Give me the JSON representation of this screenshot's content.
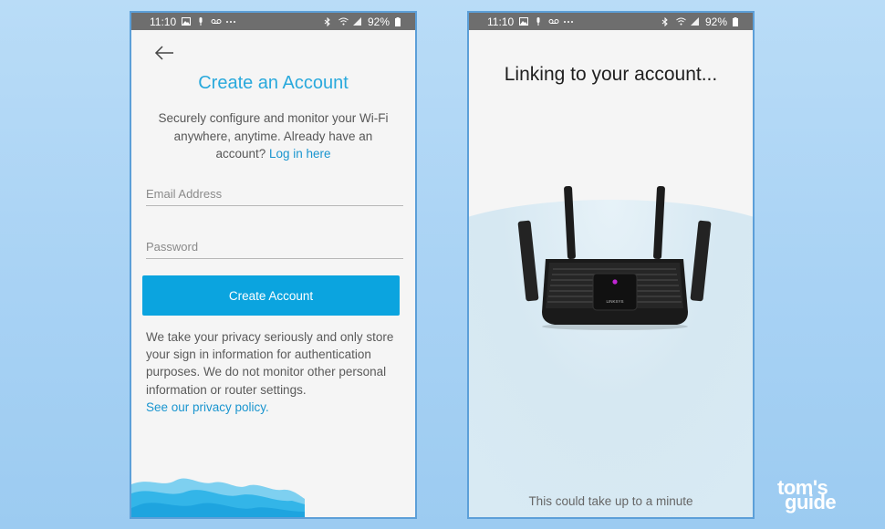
{
  "status_bar_left": {
    "time": "11:10",
    "battery": "92%",
    "icons": [
      "image-icon",
      "mic-icon",
      "voicemail-icon",
      "more-dots-icon",
      "bluetooth-icon",
      "wifi-icon",
      "signal-icon",
      "battery-icon"
    ]
  },
  "status_bar_right": {
    "time": "11:10",
    "battery": "92%"
  },
  "create_account": {
    "title": "Create an Account",
    "description": "Securely configure and monitor your Wi-Fi anywhere, anytime. Already have an account?",
    "login_link": "Log in here",
    "email_placeholder": "Email Address",
    "password_placeholder": "Password",
    "submit_label": "Create Account",
    "privacy_text": "We take your privacy seriously and only store your sign in information for authentication purposes. We do not monitor other personal information or router settings.",
    "privacy_link": "See our privacy policy."
  },
  "linking": {
    "title": "Linking to your account...",
    "router_brand": "LINKSYS",
    "footer": "This could take up to a minute"
  },
  "watermark": {
    "line1": "tom's",
    "line2": "guide"
  },
  "colors": {
    "accent": "#0ba4df",
    "title_blue": "#29a9dc",
    "status_bar": "#6e6e6e",
    "background": "#b9dcf7",
    "router_led": "#c026d3"
  }
}
